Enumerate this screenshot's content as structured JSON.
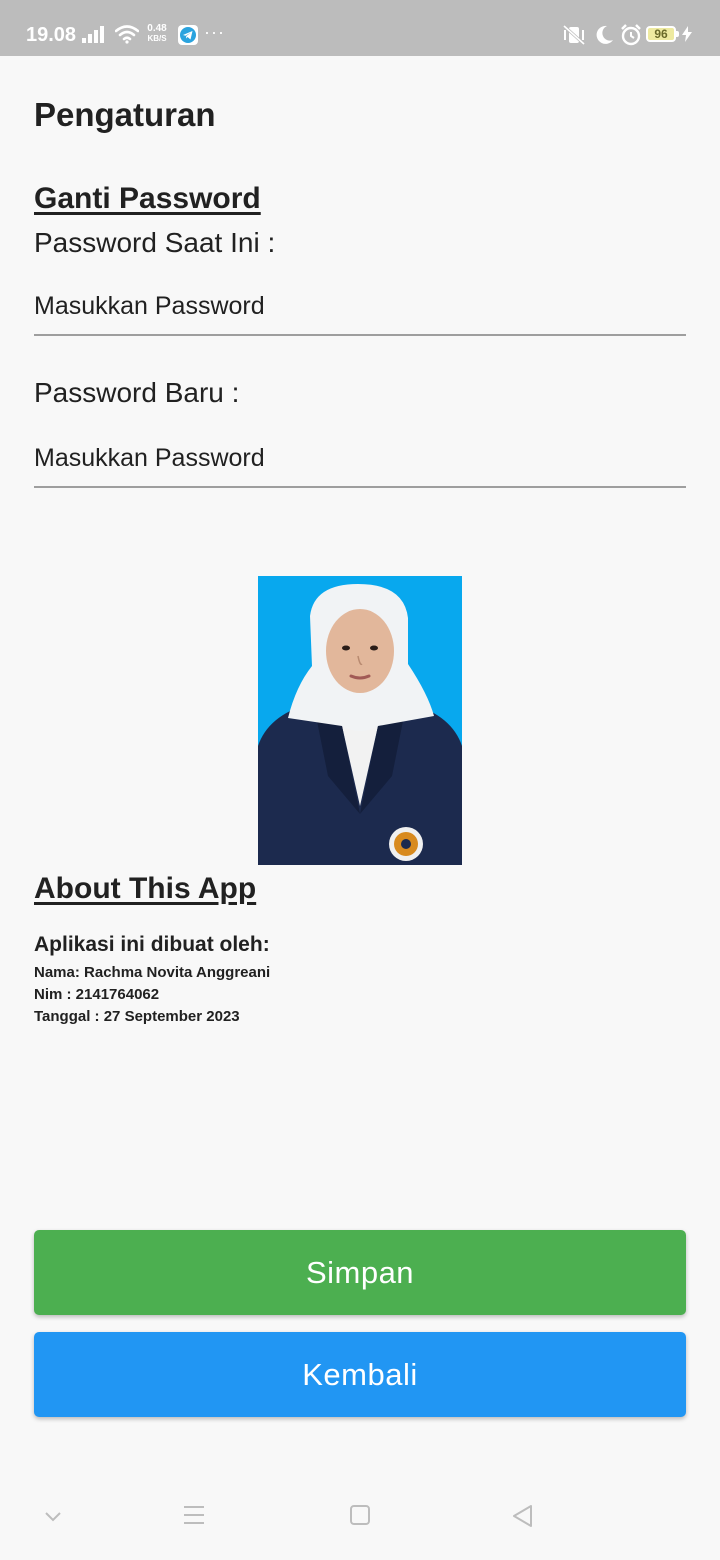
{
  "status_bar": {
    "time": "19.08",
    "net_speed_value": "0.48",
    "net_speed_unit": "KB/S",
    "more": "···",
    "battery_level": "96"
  },
  "page": {
    "title": "Pengaturan"
  },
  "password_section": {
    "title": "Ganti Password",
    "current_label": "Password Saat Ini :",
    "current_placeholder": "Masukkan Password",
    "new_label": "Password Baru :",
    "new_placeholder": "Masukkan Password"
  },
  "about": {
    "title": "About This App",
    "heading": "Aplikasi ini dibuat oleh:",
    "name": "Nama: Rachma Novita Anggreani",
    "nim": "Nim : 2141764062",
    "date": "Tanggal : 27 September 2023"
  },
  "buttons": {
    "save": "Simpan",
    "back": "Kembali"
  },
  "colors": {
    "save_button": "#4caf50",
    "back_button": "#2196f3",
    "status_bar": "#bcbcbc",
    "photo_background": "#08a8ee"
  },
  "icons": {
    "status_left": [
      "signal-icon",
      "wifi-icon",
      "telegram-icon"
    ],
    "status_right": [
      "vibrate-off-icon",
      "moon-icon",
      "alarm-icon",
      "battery-icon",
      "charging-icon"
    ],
    "nav": [
      "chevron-down-icon",
      "menu-icon",
      "square-home-icon",
      "back-triangle-icon"
    ]
  }
}
